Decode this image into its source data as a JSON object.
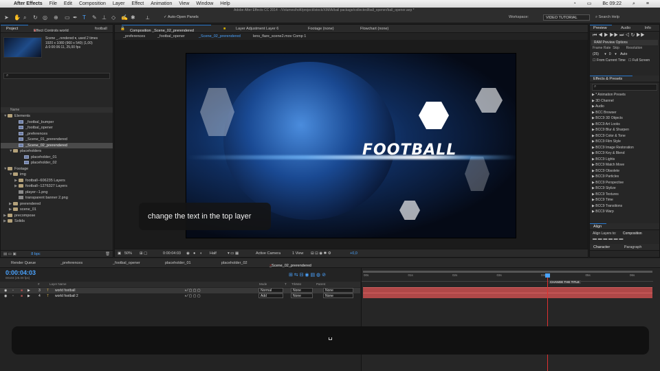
{
  "menubar": {
    "app": "After Effects",
    "items": [
      "File",
      "Edit",
      "Composition",
      "Layer",
      "Effect",
      "Animation",
      "View",
      "Window",
      "Help"
    ],
    "tray_clock": "Вс 09:22"
  },
  "toolbar": {
    "auto_open": "✓ Auto-Open Panels",
    "doc_title": "Adobe After Effects CC 2014 - /Volumes/hd4/project/istock/XIMIA/ball package/collected/ball_opener/ball_opener.aep *",
    "workspace_label": "Workspace:",
    "workspace_value": "VIDEO TUTORIAL",
    "search_help": "Search Help"
  },
  "project": {
    "tabs": [
      "Project",
      "Effect Controls world",
      "football"
    ],
    "info": [
      "Scene _..rendered ▾, used 2 times",
      "1920 x 1080  (960 x 540) (1,00)",
      "Δ 0:00:06:11, 25,00 fps"
    ],
    "search_placeholder": "",
    "col_name": "Name",
    "items": [
      {
        "label": "Elements",
        "type": "folder",
        "indent": 0,
        "arrow": "▼"
      },
      {
        "label": "_footbal_bumper",
        "type": "comp",
        "indent": 2,
        "arrow": ""
      },
      {
        "label": "_footbal_opener",
        "type": "comp",
        "indent": 2,
        "arrow": ""
      },
      {
        "label": "_preferences",
        "type": "comp",
        "indent": 2,
        "arrow": ""
      },
      {
        "label": "_Scene_01_prerendered",
        "type": "comp",
        "indent": 2,
        "arrow": ""
      },
      {
        "label": "_Scene_02_prerendered",
        "type": "comp",
        "indent": 2,
        "arrow": "",
        "selected": true
      },
      {
        "label": "placeholders",
        "type": "folder",
        "indent": 1,
        "arrow": "▼"
      },
      {
        "label": "placeholder_01",
        "type": "comp",
        "indent": 3,
        "arrow": ""
      },
      {
        "label": "placeholder_02",
        "type": "comp",
        "indent": 3,
        "arrow": ""
      },
      {
        "label": "Footage",
        "type": "folder",
        "indent": 0,
        "arrow": "▼"
      },
      {
        "label": "img",
        "type": "folder",
        "indent": 1,
        "arrow": "▼"
      },
      {
        "label": "football--606235 Layers",
        "type": "folder",
        "indent": 2,
        "arrow": "▶"
      },
      {
        "label": "football--1276327 Layers",
        "type": "folder",
        "indent": 2,
        "arrow": "▶"
      },
      {
        "label": "player--1.png",
        "type": "file",
        "indent": 2,
        "arrow": ""
      },
      {
        "label": "transparent banner 2.png",
        "type": "file",
        "indent": 2,
        "arrow": ""
      },
      {
        "label": "prerendered",
        "type": "folder",
        "indent": 1,
        "arrow": "▶"
      },
      {
        "label": "scene_01",
        "type": "folder",
        "indent": 1,
        "arrow": "▶"
      },
      {
        "label": "precompose",
        "type": "folder",
        "indent": 0,
        "arrow": "▶"
      },
      {
        "label": "Solids",
        "type": "folder",
        "indent": 0,
        "arrow": "▶"
      }
    ],
    "bpc": "8 bpc"
  },
  "comp_panel": {
    "tab_label": "Composition _Scene_02_prerendered",
    "other_tabs": [
      "Layer Adjustment Layer 6",
      "Footage (none)",
      "Flowchart (none)"
    ],
    "viewer_tabs": [
      "_preferences",
      "_footbal_opener",
      "_Scene_02_prerendered",
      "lens_flare_scene2.mov Comp 1"
    ],
    "canvas_text": "FOOTBALL",
    "footer": {
      "zoom": "50%",
      "timecode": "0:00:04:03",
      "resolution": "Half",
      "camera": "Active Camera",
      "views": "1 View",
      "exposure": "+0,0"
    }
  },
  "preview": {
    "tabs": [
      "Preview",
      "Audio",
      "Info"
    ],
    "ram_options": "RAM Preview Options",
    "frame_rate_label": "Frame Rate",
    "skip_label": "Skip",
    "resolution_label": "Resolution",
    "frame_rate": "(25)",
    "skip": "0",
    "resolution": "Auto",
    "from_current": "From Current Time",
    "full_screen": "Full Screen"
  },
  "effects": {
    "title": "Effects & Presets",
    "items": [
      "* Animation Presets",
      "3D Channel",
      "Audio",
      "BCC Browser",
      "BCC9 3D Objects",
      "BCC9 Art Looks",
      "BCC9 Blur & Sharpen",
      "BCC9 Color & Tone",
      "BCC9 Film Style",
      "BCC9 Image Restoration",
      "BCC9 Key & Blend",
      "BCC9 Lights",
      "BCC9 Match Move",
      "BCC9 Obsolete",
      "BCC9 Particles",
      "BCC9 Perspective",
      "BCC9 Stylize",
      "BCC9 Textures",
      "BCC9 Time",
      "BCC9 Transitions",
      "BCC9 Warp"
    ]
  },
  "align": {
    "title": "Align",
    "align_to_label": "Align Layers to:",
    "align_to_value": "Composition"
  },
  "character": {
    "tabs": [
      "Character",
      "Paragraph"
    ]
  },
  "timeline": {
    "tabs": [
      "Render Queue",
      "_preferences",
      "_footbal_opener",
      "placeholder_01",
      "placeholder_02",
      "_Scene_02_prerendered"
    ],
    "timecode": "0:00:04:03",
    "fps": "00103 (25.00 fps)",
    "columns": {
      "num": "#",
      "name": "Layer Name",
      "mode": "Mode",
      "t": "T",
      "trkmat": "TrkMat",
      "parent": "Parent"
    },
    "layers": [
      {
        "num": "3",
        "name": "world    football",
        "mode": "Normal",
        "trkmat": "None",
        "parent": "None"
      },
      {
        "num": "4",
        "name": "world    football 2",
        "mode": "Add",
        "trkmat": "None",
        "parent": "None"
      }
    ],
    "ruler": [
      "00s",
      "01s",
      "02s",
      "03s",
      "04s",
      "05s",
      "06s"
    ],
    "marker": "CHANGE THE TITLE"
  },
  "caption": "change the text in the top layer"
}
